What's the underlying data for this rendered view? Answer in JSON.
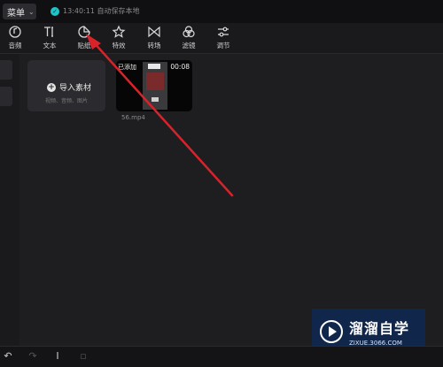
{
  "topbar": {
    "menu_label": "菜单",
    "autosave_text": "13:40:11 自动保存本地"
  },
  "toolbar": {
    "tools": [
      {
        "label": "音频",
        "icon": "audio-icon"
      },
      {
        "label": "文本",
        "icon": "text-icon"
      },
      {
        "label": "贴纸",
        "icon": "sticker-icon"
      },
      {
        "label": "特效",
        "icon": "effects-icon"
      },
      {
        "label": "转场",
        "icon": "transition-icon"
      },
      {
        "label": "滤镜",
        "icon": "filter-icon"
      },
      {
        "label": "调节",
        "icon": "adjust-icon"
      }
    ]
  },
  "media": {
    "import_label": "导入素材",
    "import_sub": "视频、音频、图片",
    "clip": {
      "badge": "已添加",
      "duration": "00:08",
      "name": "56.mp4"
    }
  },
  "watermark": {
    "title": "溜溜自学",
    "url": "ZIXUE.3066.COM"
  },
  "colors": {
    "annotation_arrow": "#d8232a",
    "accent": "#20c3c9"
  }
}
